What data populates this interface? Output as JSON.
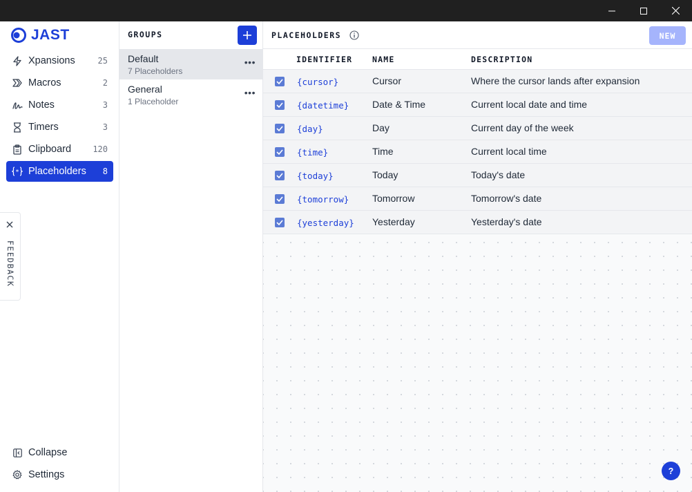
{
  "app": {
    "logo_text": "JAST"
  },
  "sidebar": {
    "items": [
      {
        "label": "Xpansions",
        "count": "25",
        "icon": "lightning-icon"
      },
      {
        "label": "Macros",
        "count": "2",
        "icon": "chevrons-right-icon"
      },
      {
        "label": "Notes",
        "count": "3",
        "icon": "scribble-icon"
      },
      {
        "label": "Timers",
        "count": "3",
        "icon": "hourglass-icon"
      },
      {
        "label": "Clipboard",
        "count": "120",
        "icon": "clipboard-icon"
      },
      {
        "label": "Placeholders",
        "count": "8",
        "icon": "braces-asterisk-icon",
        "active": true
      }
    ],
    "bottom": [
      {
        "label": "Collapse",
        "icon": "sidebar-collapse-icon"
      },
      {
        "label": "Settings",
        "icon": "gear-icon"
      }
    ],
    "feedback_label": "FEEDBACK"
  },
  "groups": {
    "header": "GROUPS",
    "items": [
      {
        "name": "Default",
        "subtitle": "7 Placeholders",
        "selected": true
      },
      {
        "name": "General",
        "subtitle": "1 Placeholder",
        "selected": false
      }
    ]
  },
  "main": {
    "title": "PLACEHOLDERS",
    "new_label": "NEW",
    "columns": {
      "identifier": "IDENTIFIER",
      "name": "NAME",
      "description": "DESCRIPTION"
    },
    "rows": [
      {
        "identifier": "{cursor}",
        "name": "Cursor",
        "description": "Where the cursor lands after expansion",
        "checked": true
      },
      {
        "identifier": "{datetime}",
        "name": "Date & Time",
        "description": "Current local date and time",
        "checked": true
      },
      {
        "identifier": "{day}",
        "name": "Day",
        "description": "Current day of the week",
        "checked": true
      },
      {
        "identifier": "{time}",
        "name": "Time",
        "description": "Current local time",
        "checked": true
      },
      {
        "identifier": "{today}",
        "name": "Today",
        "description": "Today's date",
        "checked": true
      },
      {
        "identifier": "{tomorrow}",
        "name": "Tomorrow",
        "description": "Tomorrow's date",
        "checked": true
      },
      {
        "identifier": "{yesterday}",
        "name": "Yesterday",
        "description": "Yesterday's date",
        "checked": true
      }
    ]
  },
  "help_label": "?",
  "colors": {
    "accent": "#1d3fd8",
    "titlebar": "#202020",
    "new_button_disabled": "#a5b4fc"
  }
}
